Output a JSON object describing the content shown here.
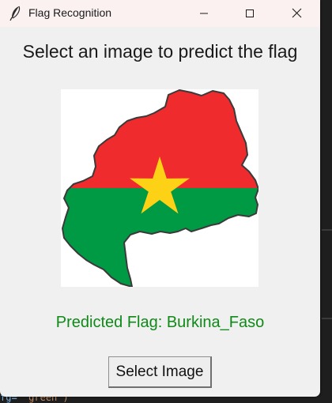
{
  "window": {
    "title": "Flag Recognition",
    "app_icon": "feather-icon",
    "controls": [
      "minimize-icon",
      "maximize-icon",
      "close-icon"
    ]
  },
  "main": {
    "heading": "Select an image to predict the flag",
    "image_alt": "Burkina Faso flag map",
    "prediction_text": "Predicted Flag: Burkina_Faso",
    "select_button_label": "Select Image"
  },
  "background_code": {
    "line_prefix": "fg=",
    "line_string": "\"green\")"
  },
  "colors": {
    "prediction_text": "#0f8a18",
    "flag_red": "#ef2b2d",
    "flag_green": "#009a44",
    "flag_star": "#fcd116",
    "window_bg": "#f0f0f0",
    "titlebar_bg": "#fbf1f1"
  }
}
